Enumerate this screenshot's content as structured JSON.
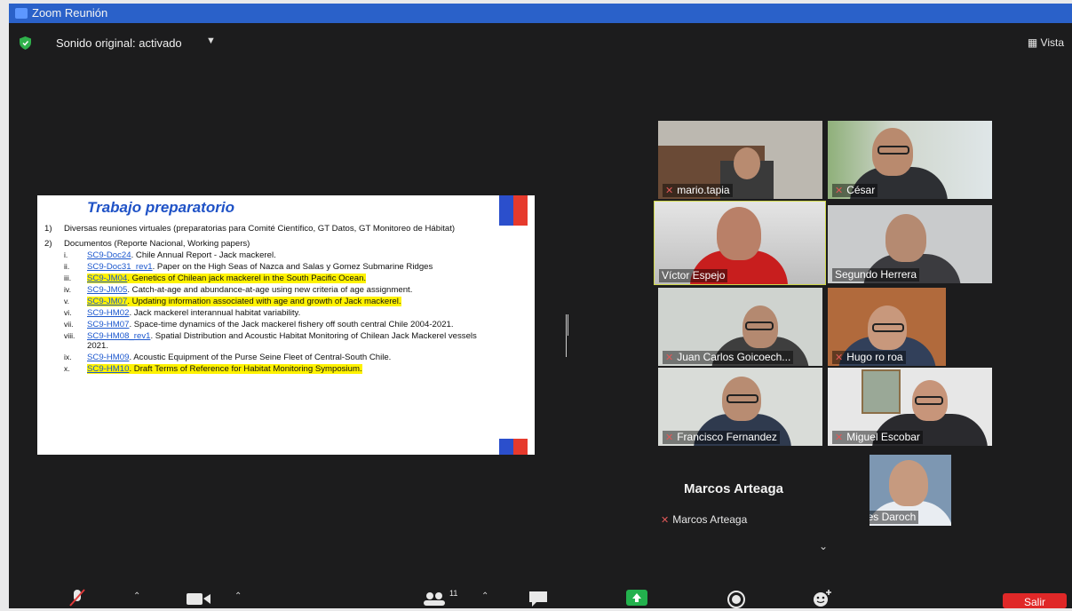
{
  "window": {
    "title": "Zoom Reunión"
  },
  "topbar": {
    "sound_label": "Sonido original: activado",
    "view_label": "Vista",
    "icons": [
      "shield-icon",
      "chevron-down-icon",
      "grid-icon"
    ]
  },
  "slide": {
    "title": "Trabajo preparatorio",
    "items": [
      {
        "num": "1)",
        "text": "Diversas reuniones virtuales (preparatorias para Comité Científico, GT Datos,  GT Monitoreo de Hábitat)"
      },
      {
        "num": "2)",
        "text": "Documentos (Reporte Nacional, Working papers)"
      }
    ],
    "docs": [
      {
        "rn": "i.",
        "link": "SC9-Doc24",
        "text": ". Chile Annual Report - Jack mackerel.",
        "highlight": false
      },
      {
        "rn": "ii.",
        "link": "SC9-Doc31_rev1",
        "text": ". Paper on the High Seas of Nazca and Salas y Gomez Submarine Ridges",
        "highlight": false
      },
      {
        "rn": "iii.",
        "link": "SC9-JM04",
        "text": ". Genetics of Chilean jack mackerel in the South Pacific Ocean.",
        "highlight": true
      },
      {
        "rn": "iv.",
        "link": "SC9-JM05",
        "text": ". Catch-at-age and abundance-at-age using new criteria of age assignment.",
        "highlight": false
      },
      {
        "rn": "v.",
        "link": "SC9-JM07",
        "text": ". Updating information associated with age and growth of Jack mackerel.",
        "highlight": true
      },
      {
        "rn": "vi.",
        "link": "SC9-HM02",
        "text": ". Jack mackerel interannual habitat variability.",
        "highlight": false
      },
      {
        "rn": "vii.",
        "link": "SC9-HM07",
        "text": ". Space-time dynamics of the Jack mackerel fishery off south central Chile 2004-2021.",
        "highlight": false
      },
      {
        "rn": "viii.",
        "link": "SC9-HM08_rev1",
        "text": ". Spatial Distribution and Acoustic Habitat Monitoring of Chilean Jack Mackerel vessels 2021.",
        "highlight": false
      },
      {
        "rn": "ix.",
        "link": "SC9-HM09",
        "text": ". Acoustic Equipment of the Purse Seine Fleet of Central-South Chile.",
        "highlight": false
      },
      {
        "rn": "x.",
        "link": "SC9-HM10",
        "text": ". Draft Terms of Reference for Habitat Monitoring Symposium.",
        "highlight": true
      }
    ]
  },
  "participants": [
    {
      "name": "mario.tapia",
      "muted": true
    },
    {
      "name": "César",
      "muted": true
    },
    {
      "name": "Víctor Espejo",
      "muted": false,
      "active": true
    },
    {
      "name": "Segundo Herrera",
      "muted": false
    },
    {
      "name": "Juan Carlos Goicoech...",
      "muted": true
    },
    {
      "name": "Hugo ro roa",
      "muted": true
    },
    {
      "name": "Francisco Fernandez",
      "muted": true
    },
    {
      "name": "Miguel Escobar",
      "muted": true
    },
    {
      "name": "Marcos Arteaga",
      "muted": true,
      "video": false
    },
    {
      "name": "Andres Daroch",
      "muted": true
    }
  ],
  "no_video_name": "Marcos Arteaga",
  "toolbar": {
    "participants_count": "11",
    "leave_label": "Salir",
    "icons": [
      "microphone-muted-icon",
      "video-camera-icon",
      "participants-icon",
      "chat-icon",
      "share-screen-icon",
      "record-icon",
      "reactions-icon"
    ]
  },
  "colors": {
    "title_bar": "#2a61c9",
    "slide_title": "#1f52c6",
    "highlight": "#fff200",
    "active_speaker": "#cfd74a",
    "leave": "#e02828"
  }
}
